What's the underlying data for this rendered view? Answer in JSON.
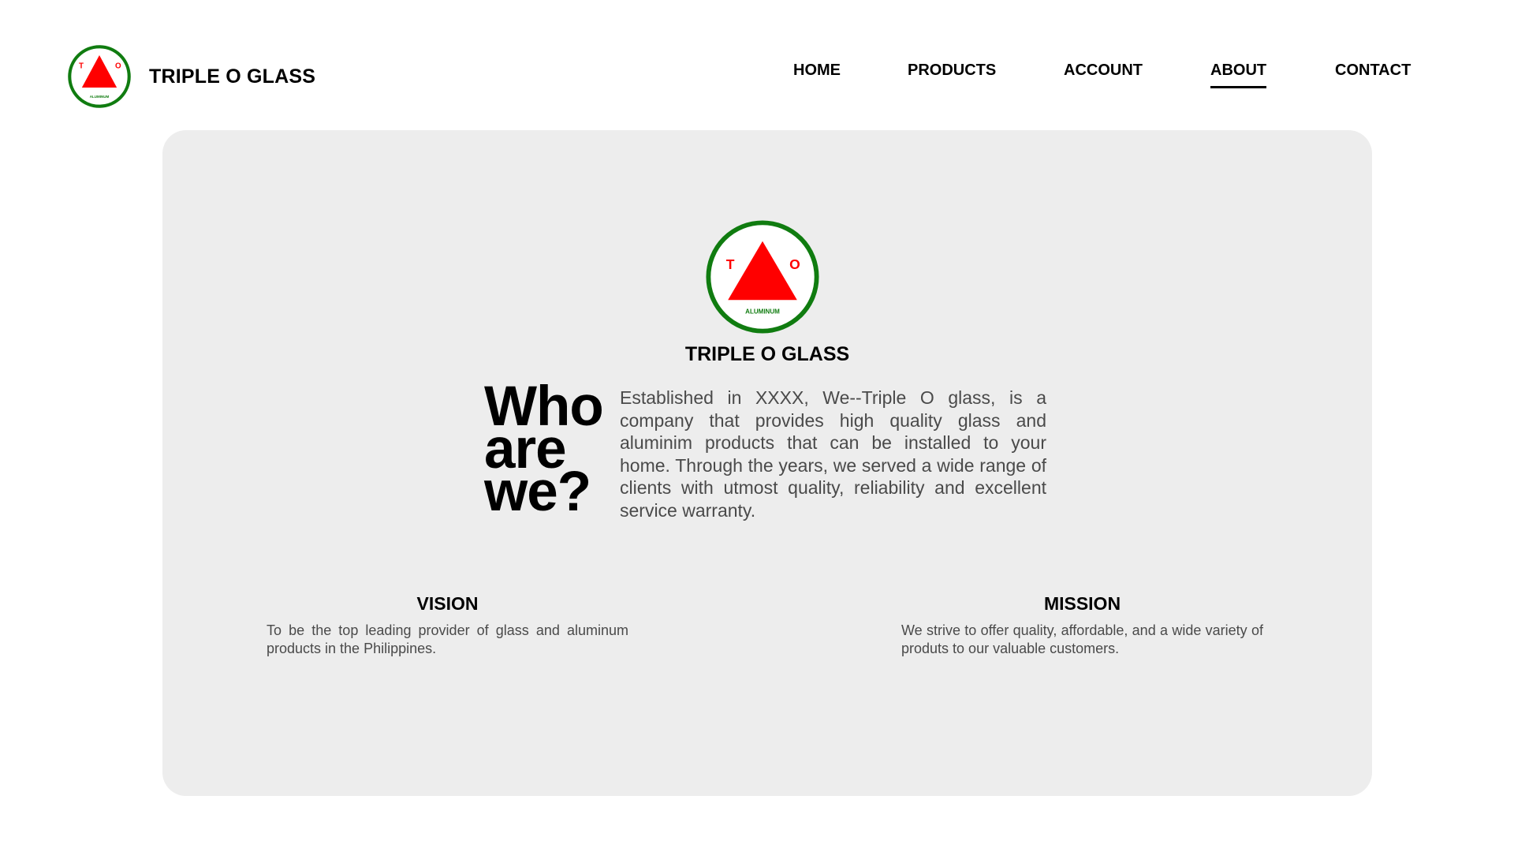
{
  "brand": {
    "name": "TRIPLE O GLASS",
    "logo": {
      "left_letter": "T",
      "right_letter": "O",
      "caption": "ALUMINUM"
    }
  },
  "nav": {
    "items": [
      {
        "label": "HOME",
        "active": false
      },
      {
        "label": "PRODUCTS",
        "active": false
      },
      {
        "label": "ACCOUNT",
        "active": false
      },
      {
        "label": "ABOUT",
        "active": true
      },
      {
        "label": "CONTACT",
        "active": false
      }
    ]
  },
  "about": {
    "company_name": "TRIPLE O GLASS",
    "heading_lines": [
      "Who",
      "are",
      "we?"
    ],
    "description": "Established in XXXX, We--Triple O glass, is a company that provides high quality glass and aluminim products that can be installed to your home. Through the years, we served a wide range of clients with utmost quality, reliability and excellent service warranty."
  },
  "vision": {
    "title": "VISION",
    "text": "To be the top leading provider of glass and aluminum products in the Philippines."
  },
  "mission": {
    "title": "MISSION",
    "text": "We strive to offer quality, affordable, and a wide variety of produts to our valuable customers."
  },
  "colors": {
    "logo_ring": "#107c10",
    "logo_triangle": "#ff0000",
    "card_background": "#ededed",
    "body_text": "#4a4a4a"
  }
}
